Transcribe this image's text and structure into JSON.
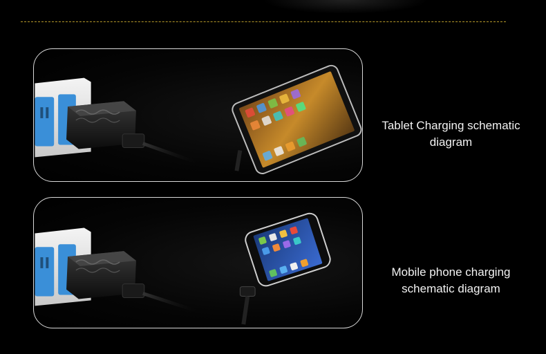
{
  "captions": {
    "tablet": {
      "line1": "Tablet Charging schematic",
      "line2": "diagram"
    },
    "phone": {
      "line1": "Mobile phone charging",
      "line2": "schematic diagram"
    }
  },
  "images": {
    "tablet_scene": "power-strip-charger-cable-tablet",
    "phone_scene": "power-strip-charger-cable-phone"
  },
  "colors": {
    "background": "#000000",
    "divider": "#b89a2a",
    "panel_border": "#d9d9d9",
    "socket_blue": "#3a8fd8"
  }
}
